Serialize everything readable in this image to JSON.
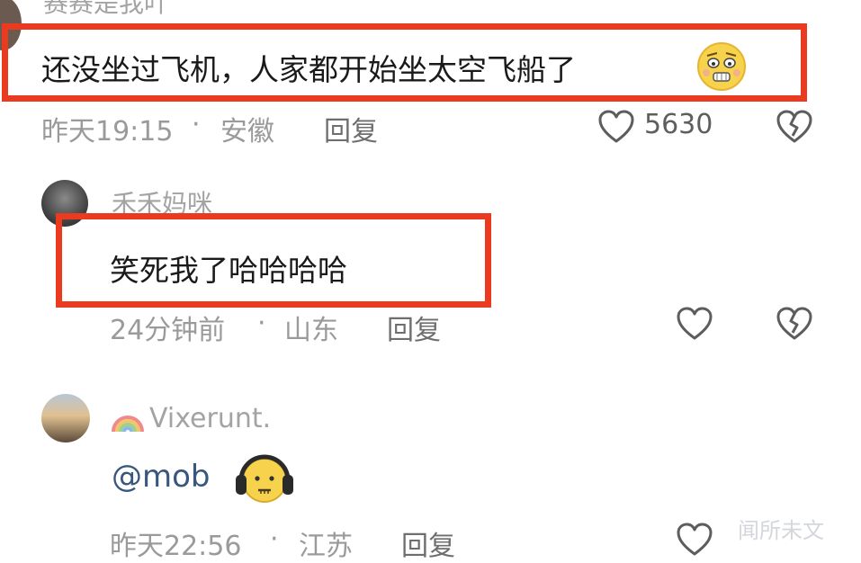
{
  "comments": [
    {
      "username": "赛赛是我吖",
      "text": "还没坐过飞机，人家都开始坐太空飞船了",
      "time": "昨天19:15",
      "location": "安徽",
      "reply_label": "回复",
      "like_count": "5630"
    },
    {
      "username": "禾禾妈咪",
      "text": "笑死我了哈哈哈哈",
      "time": "24分钟前",
      "location": "山东",
      "reply_label": "回复"
    },
    {
      "username": "Vixerunt.",
      "mention": "@mob",
      "time": "昨天22:56",
      "location": "江苏",
      "reply_label": "回复"
    }
  ],
  "separator": "·",
  "watermark": "闻所未文",
  "colors": {
    "highlight_box": "#ea3a1f",
    "mention": "#38577f",
    "secondary_text": "#9a9a9a"
  },
  "icons": {
    "like": "heart-outline-icon",
    "dislike": "broken-heart-icon",
    "emoji1": "scared-face-emoji",
    "emoji2": "headphones-face-emoji",
    "rainbow": "rainbow-emoji"
  }
}
